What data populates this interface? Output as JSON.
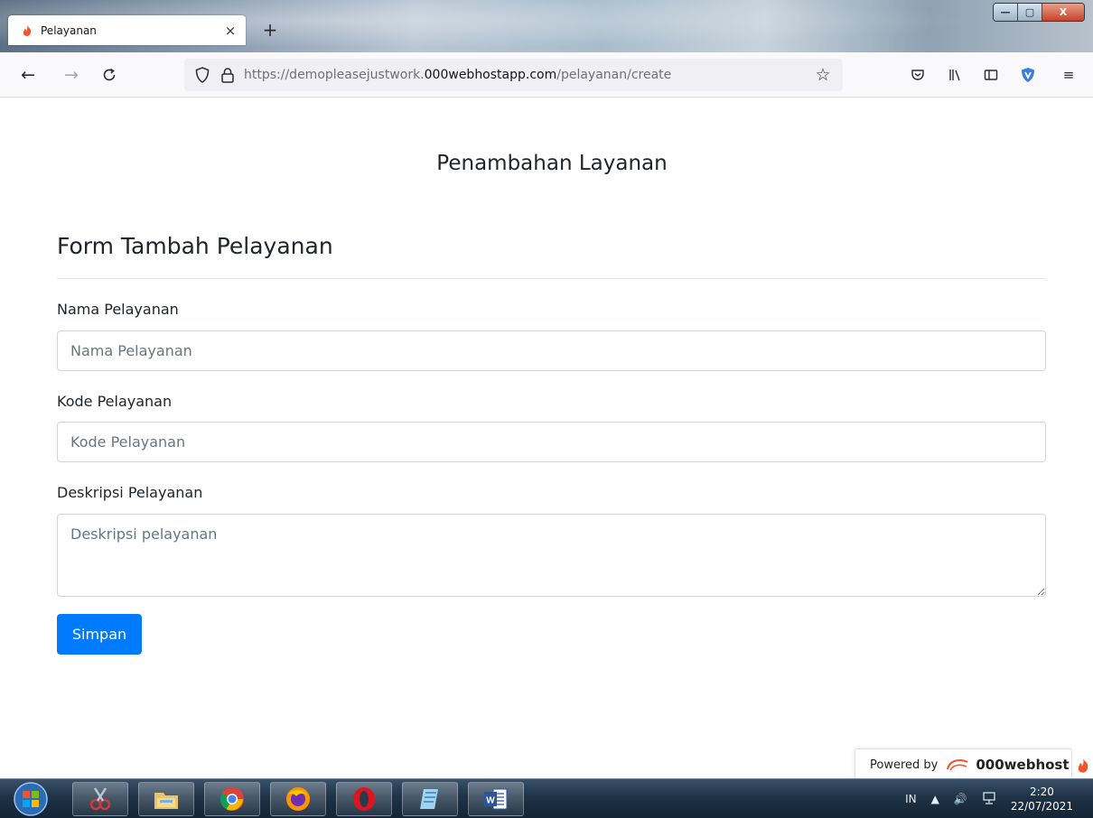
{
  "browser": {
    "tab_title": "Pelayanan",
    "tab_close": "×",
    "new_tab": "+",
    "url_prefix": "https://demopleasejustwork.",
    "url_domain": "000webhostapp.com",
    "url_path": "/pelayanan/create",
    "window_controls": {
      "minimize": "—",
      "maximize": "▢",
      "close": "X"
    }
  },
  "page": {
    "header_title": "Penambahan Layanan",
    "form_title": "Form Tambah Pelayanan",
    "fields": [
      {
        "label": "Nama Pelayanan",
        "placeholder": "Nama Pelayanan",
        "value": ""
      },
      {
        "label": "Kode Pelayanan",
        "placeholder": "Kode Pelayanan",
        "value": ""
      },
      {
        "label": "Deskripsi Pelayanan",
        "placeholder": "Deskripsi pelayanan",
        "value": ""
      }
    ],
    "submit_label": "Simpan",
    "accent_color": "#007bff"
  },
  "powered_by": {
    "prefix": "Powered by",
    "brand": "000webhost"
  },
  "taskbar": {
    "language": "IN",
    "time": "2:20",
    "date": "22/07/2021",
    "apps": [
      "windows-start-orb",
      "snipping-tool-icon",
      "file-explorer-icon",
      "chrome-icon",
      "firefox-icon",
      "opera-icon",
      "notepad-icon",
      "word-icon"
    ]
  }
}
